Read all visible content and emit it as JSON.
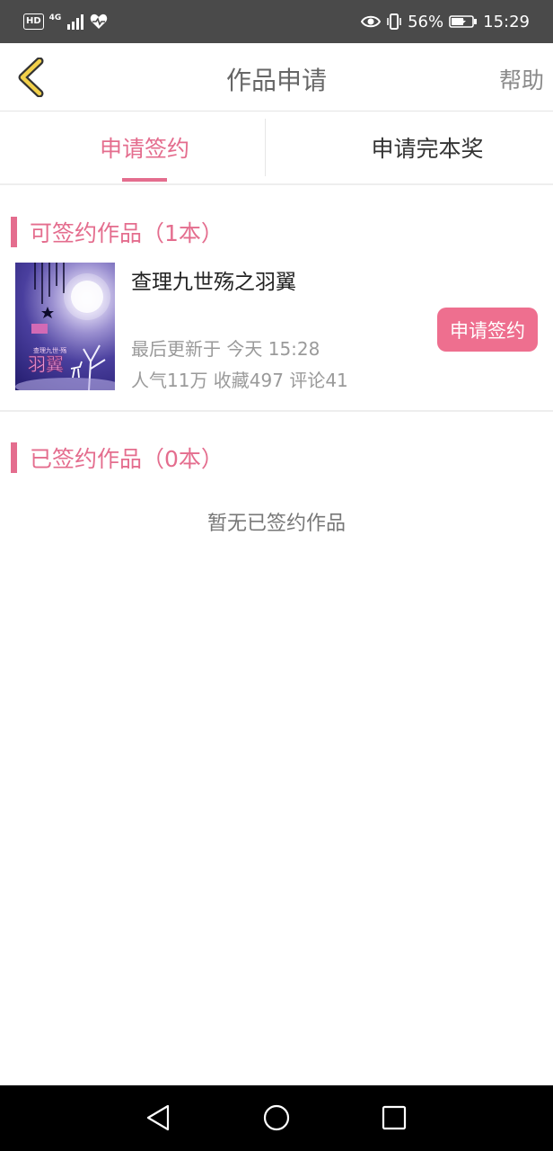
{
  "status_bar": {
    "hd_label": "HD",
    "network_label": "4G",
    "battery_percent": "56%",
    "time": "15:29",
    "icons": [
      "signal-icon",
      "health-heart-icon",
      "eye-comfort-icon",
      "vibrate-icon",
      "battery-icon"
    ]
  },
  "header": {
    "title": "作品申请",
    "help_label": "帮助",
    "back_icon": "chevron-left-icon"
  },
  "tabs": [
    {
      "label": "申请签约",
      "active": true
    },
    {
      "label": "申请完本奖",
      "active": false
    }
  ],
  "signable": {
    "title": "可签约作品（1本）",
    "books": [
      {
        "title": "查理九世殇之羽翼",
        "updated": "最后更新于 今天 15:28",
        "stats": "人气11万  收藏497  评论41",
        "apply_label": "申请签约",
        "cover_text": "羽翼"
      }
    ]
  },
  "signed": {
    "title": "已签约作品（0本）",
    "empty_text": "暂无已签约作品"
  },
  "colors": {
    "accent": "#e46d8e",
    "button": "#ee6f8f",
    "status_bar": "#4a4a4a",
    "nav_bar": "#000000"
  },
  "nav_bar": {
    "icons": [
      "back-triangle-icon",
      "home-circle-icon",
      "recents-square-icon"
    ]
  }
}
